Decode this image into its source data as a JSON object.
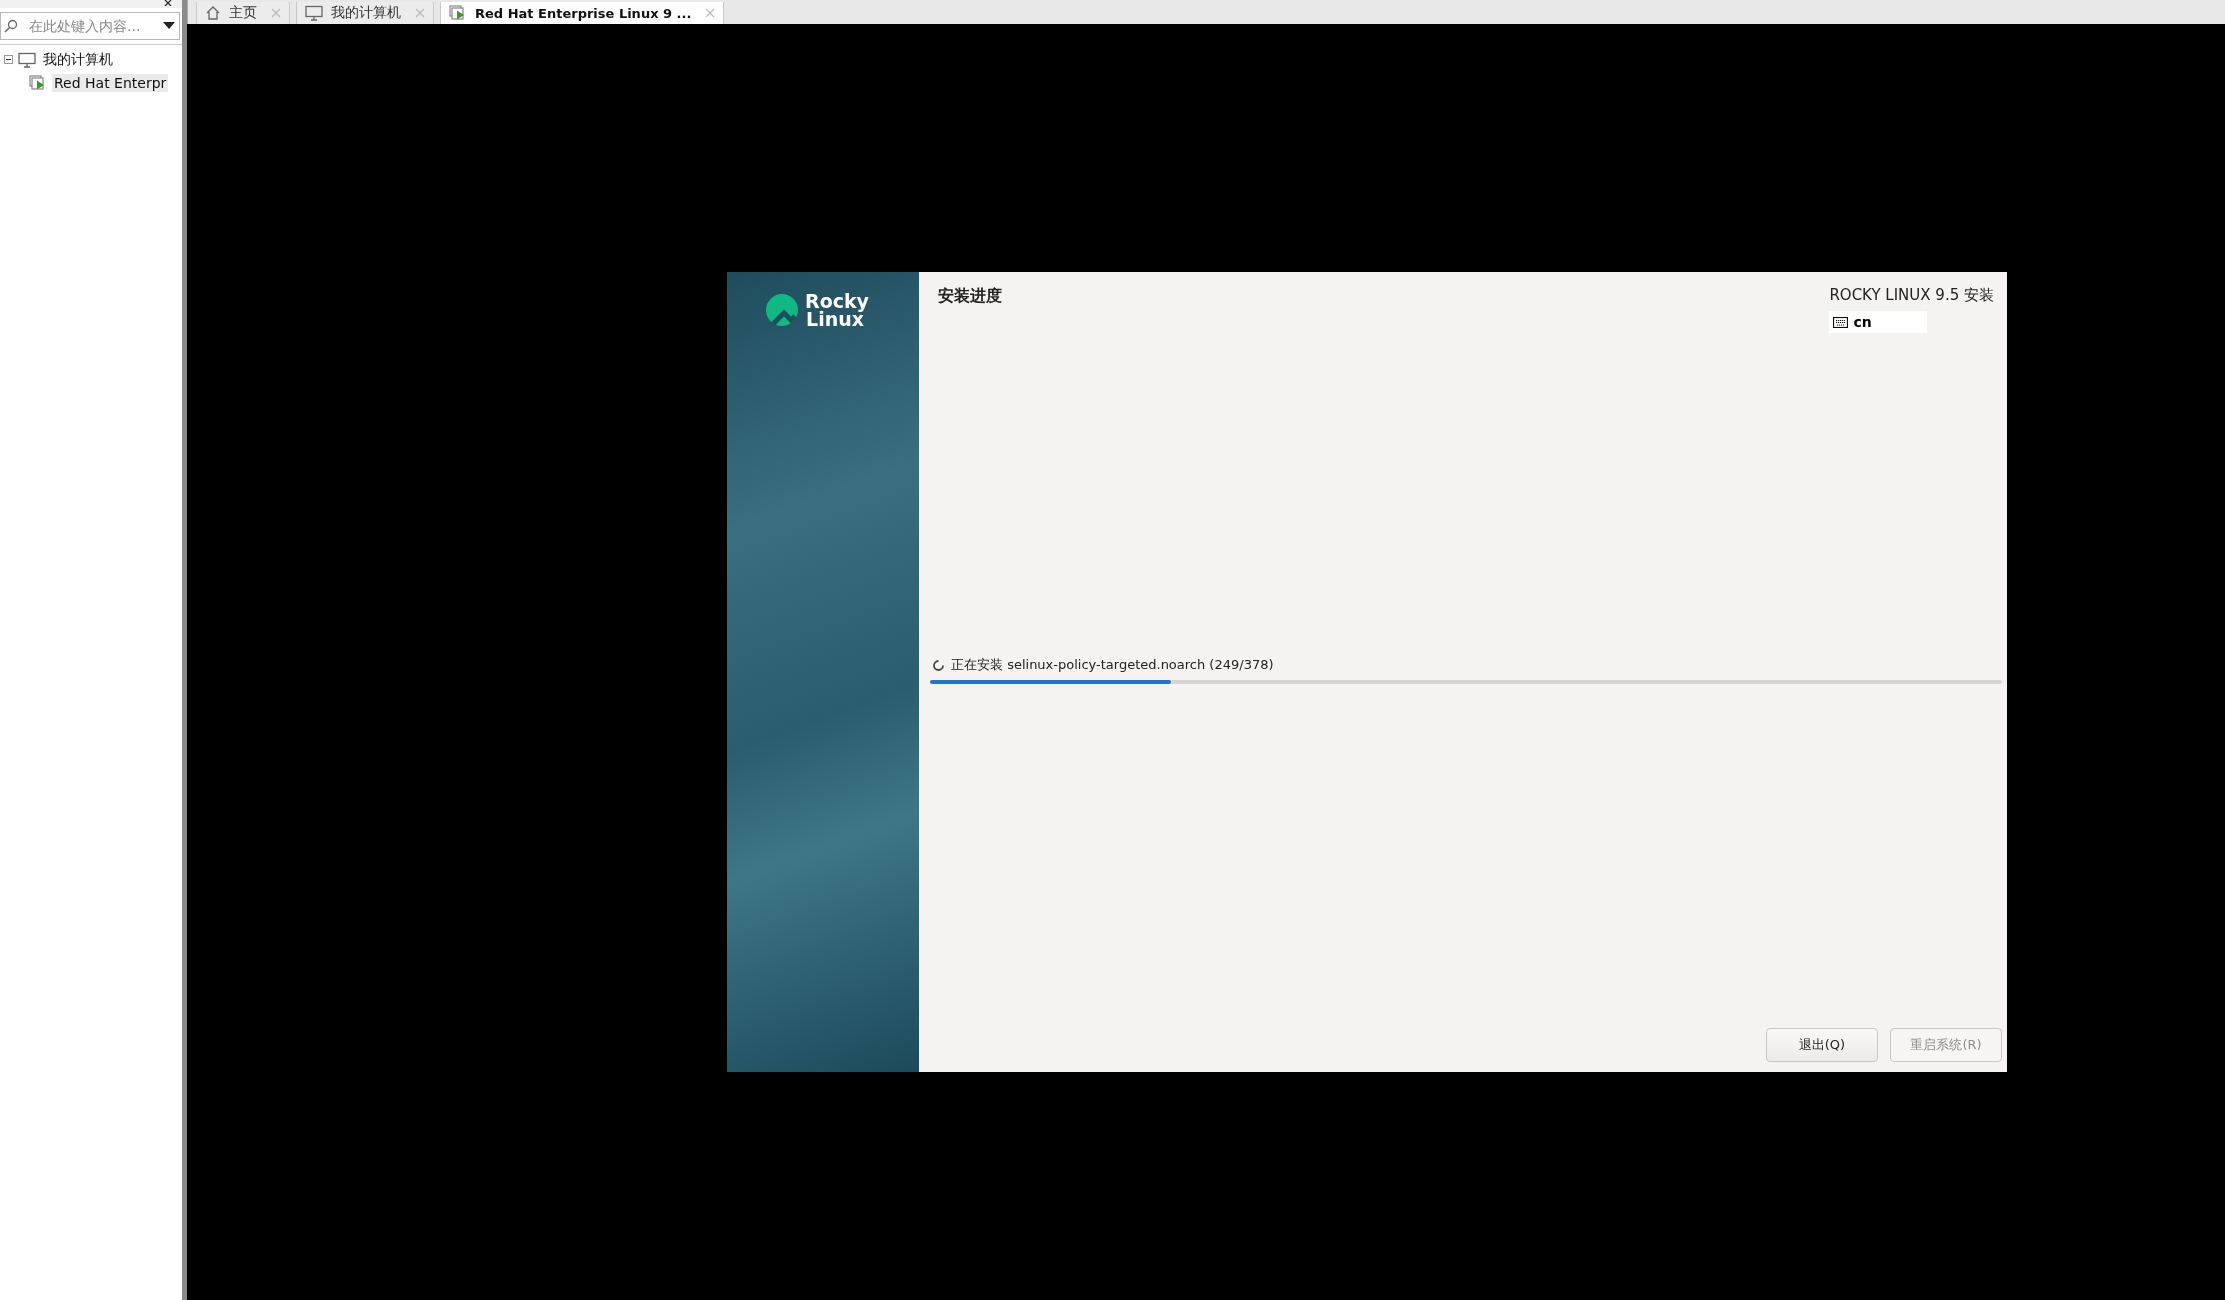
{
  "host_tabs": [
    {
      "kind": "home",
      "label": "主页",
      "selected": false
    },
    {
      "kind": "computer",
      "label": "我的计算机",
      "selected": false
    },
    {
      "kind": "vm",
      "label": "Red Hat Enterprise Linux 9 ...",
      "selected": true
    }
  ],
  "library": {
    "search": {
      "placeholder": "在此处键入内容..."
    },
    "tree": [
      {
        "label": "我的计算机",
        "kind": "computer",
        "expanded": true,
        "selected": false,
        "children": [
          {
            "label": "Red Hat Enterpr",
            "kind": "vm",
            "selected": true
          }
        ]
      }
    ]
  },
  "installer": {
    "brand": "Rocky Linux",
    "title": "安装进度",
    "product": "ROCKY LINUX 9.5 安装",
    "keyboard_layout": "cn",
    "progress": {
      "message": "正在安装 selinux-policy-targeted.noarch (249/378)",
      "level": 0.225
    },
    "buttons": [
      {
        "label": "退出(Q)",
        "disabled": false
      },
      {
        "label": "重启系统(R)",
        "disabled": true
      }
    ]
  }
}
